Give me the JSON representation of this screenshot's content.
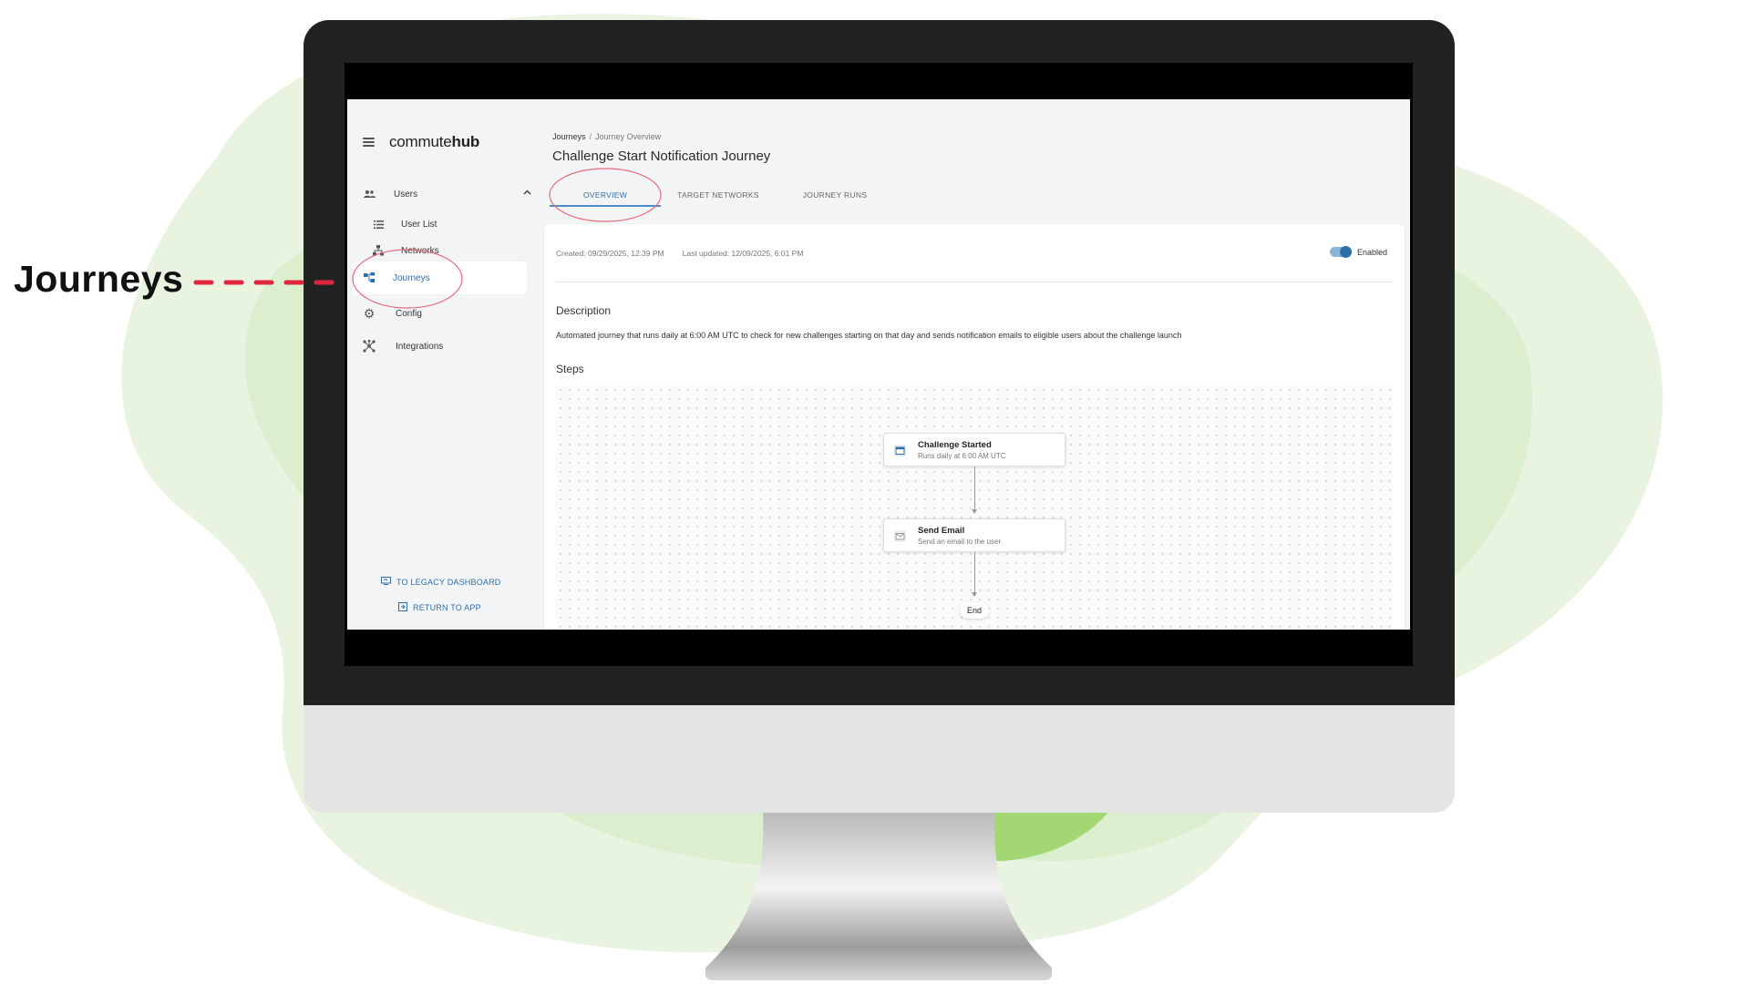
{
  "annotation": {
    "label": "Journeys",
    "color": "#e0253f"
  },
  "colors": {
    "accent": "#2f6fa8",
    "bezel": "#222222",
    "blob": "#dcefcf",
    "blob_bright": "#9fd66e"
  },
  "app": {
    "brand": {
      "light": "commute",
      "bold": "hub"
    },
    "sidebar": {
      "users": {
        "label": "Users",
        "icon": "users-icon"
      },
      "user_list": {
        "label": "User List",
        "icon": "list-icon"
      },
      "networks": {
        "label": "Networks",
        "icon": "network-icon"
      },
      "journeys": {
        "label": "Journeys",
        "icon": "journeys-icon"
      },
      "config": {
        "label": "Config",
        "icon": "gear-icon"
      },
      "integrations": {
        "label": "Integrations",
        "icon": "integrations-icon"
      },
      "legacy_link": "TO LEGACY DASHBOARD",
      "return_link": "RETURN TO APP"
    },
    "breadcrumb": {
      "root": "Journeys",
      "separator": "/",
      "current": "Journey Overview"
    },
    "page_title": "Challenge Start Notification Journey",
    "tabs": [
      "OVERVIEW",
      "TARGET NETWORKS",
      "JOURNEY RUNS"
    ],
    "active_tab": "OVERVIEW",
    "meta": {
      "created": "Created: 09/29/2025, 12:39 PM",
      "updated": "Last updated: 12/09/2025, 6:01 PM"
    },
    "toggle": {
      "label": "Enabled",
      "on": true
    },
    "description": {
      "heading": "Description",
      "text": "Automated journey that runs daily at 6:00 AM UTC to check for new challenges starting on that day and sends notification emails to eligible users about the challenge launch"
    },
    "steps": {
      "heading": "Steps",
      "nodes": [
        {
          "title": "Challenge Started",
          "subtitle": "Runs daily at 6:00 AM UTC",
          "icon": "calendar-icon"
        },
        {
          "title": "Send Email",
          "subtitle": "Send an email to the user",
          "icon": "email-icon"
        }
      ],
      "end_label": "End"
    }
  }
}
